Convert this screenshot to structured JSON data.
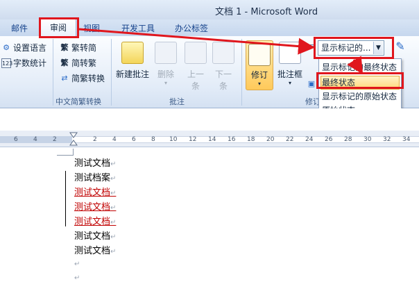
{
  "window": {
    "title": "文档 1 - Microsoft Word"
  },
  "tabs": [
    {
      "label": "邮件"
    },
    {
      "label": "审阅"
    },
    {
      "label": "视图"
    },
    {
      "label": "开发工具"
    },
    {
      "label": "办公标签"
    }
  ],
  "ribbon": {
    "proofing": {
      "set_language": "设置语言",
      "word_count": "字数统计"
    },
    "chinese_conversion": {
      "label": "中文简繁转换",
      "trad_to_simp": "繁转简",
      "simp_to_trad": "简转繁",
      "convert": "简繁转换"
    },
    "comments": {
      "label": "批注",
      "new_comment": "新建批注",
      "delete": "删除",
      "prev_1": "上一",
      "prev_2": "条",
      "next_1": "下一",
      "next_2": "条"
    },
    "tracking": {
      "label": "修订",
      "track_changes": "修订",
      "balloons": "批注框",
      "display_value": "显示标记的...",
      "menu_items": [
        "显示标记的最终状态",
        "最终状态",
        "显示标记的原始状态",
        "原始状态"
      ]
    }
  },
  "ruler": {
    "ticks": [
      "6",
      "4",
      "2",
      "2",
      "4",
      "6",
      "8",
      "10",
      "12",
      "14",
      "16",
      "18",
      "20",
      "22",
      "24",
      "26",
      "28",
      "30",
      "32",
      "34"
    ]
  },
  "document": {
    "paragraph_mark": "↵",
    "lines": [
      {
        "text": "测试文档",
        "changed": false
      },
      {
        "text": "测试档案",
        "changed": false
      },
      {
        "text": "测试文档",
        "changed": true
      },
      {
        "text": "测试文档",
        "changed": true
      },
      {
        "text": "测试文档",
        "changed": true
      },
      {
        "text": "测试文档",
        "changed": false
      },
      {
        "text": "测试文档",
        "changed": false
      }
    ]
  },
  "colors": {
    "highlight_box": "#e0161d",
    "tracked_change": "#c00000",
    "accent": "#15428b"
  }
}
